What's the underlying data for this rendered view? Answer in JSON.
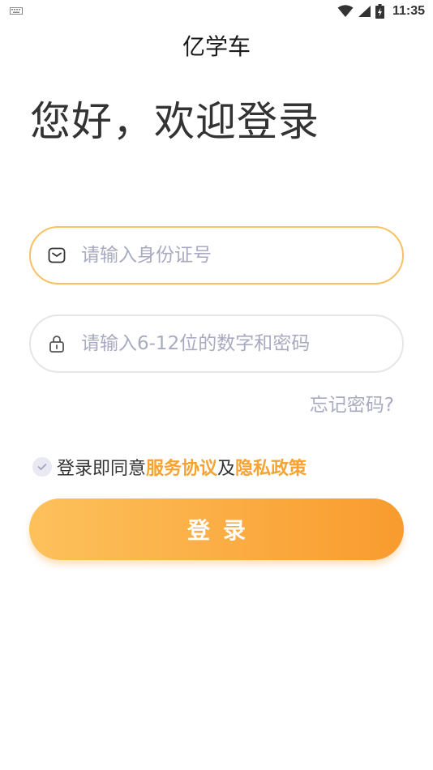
{
  "status_bar": {
    "time": "11:35",
    "icons": [
      "keyboard-icon",
      "wifi-icon",
      "signal-icon",
      "battery-icon"
    ]
  },
  "app": {
    "title": "亿学车"
  },
  "greeting": "您好，欢迎登录",
  "form": {
    "id_field": {
      "placeholder": "请输入身份证号",
      "value": "",
      "icon": "id-card-icon"
    },
    "password_field": {
      "placeholder": "请输入6-12位的数字和密码",
      "value": "",
      "icon": "lock-icon"
    },
    "forgot_password": "忘记密码?"
  },
  "agreement": {
    "checked": true,
    "prefix": "登录即同意",
    "service_link": "服务协议",
    "conjunction": "及",
    "privacy_link": "隐私政策"
  },
  "login_button": "登录",
  "colors": {
    "accent": "#f6a332",
    "gradient_start": "#fdc15c",
    "gradient_end": "#f99b2e",
    "active_border": "#f7c163",
    "placeholder": "#a8aac0"
  }
}
